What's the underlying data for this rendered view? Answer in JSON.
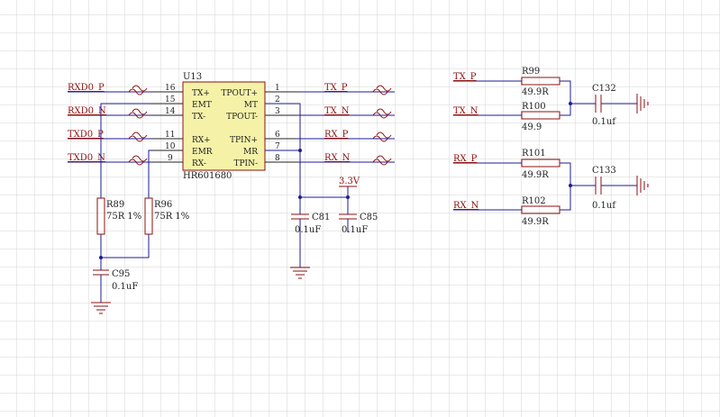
{
  "ic": {
    "ref": "U13",
    "part": "HR601680",
    "left_pins": [
      {
        "num": "16",
        "name": "TX+",
        "net": "RXD0_P"
      },
      {
        "num": "15",
        "name": "EMT",
        "net": ""
      },
      {
        "num": "14",
        "name": "TX-",
        "net": "RXD0_N"
      },
      {
        "num": "11",
        "name": "RX+",
        "net": "TXD0_P"
      },
      {
        "num": "10",
        "name": "EMR",
        "net": ""
      },
      {
        "num": "9",
        "name": "RX-",
        "net": "TXD0_N"
      }
    ],
    "right_pins": [
      {
        "num": "1",
        "name": "TPOUT+",
        "net": "TX_P"
      },
      {
        "num": "2",
        "name": "MT",
        "net": ""
      },
      {
        "num": "3",
        "name": "TPOUT-",
        "net": "TX_N"
      },
      {
        "num": "6",
        "name": "TPIN+",
        "net": "RX_P"
      },
      {
        "num": "7",
        "name": "MR",
        "net": ""
      },
      {
        "num": "8",
        "name": "TPIN-",
        "net": "RX_N"
      }
    ]
  },
  "resistors": {
    "r89": {
      "ref": "R89",
      "value": "75R 1%"
    },
    "r96": {
      "ref": "R96",
      "value": "75R 1%"
    },
    "r99": {
      "ref": "R99",
      "value": "49.9R"
    },
    "r100": {
      "ref": "R100",
      "value": "49.9"
    },
    "r101": {
      "ref": "R101",
      "value": "49.9R"
    },
    "r102": {
      "ref": "R102",
      "value": "49.9R"
    }
  },
  "capacitors": {
    "c95": {
      "ref": "C95",
      "value": "0.1uF"
    },
    "c81": {
      "ref": "C81",
      "value": "0.1uF"
    },
    "c85": {
      "ref": "C85",
      "value": "0.1uF"
    },
    "c132": {
      "ref": "C132",
      "value": "0.1uf"
    },
    "c133": {
      "ref": "C133",
      "value": "0.1uf"
    }
  },
  "power": {
    "label": "3.3V"
  },
  "nets_right_block": {
    "tx_p": "TX_P",
    "tx_n": "TX_N",
    "rx_p": "RX_P",
    "rx_n": "RX_N"
  },
  "colors": {
    "wire": "#1b1b9a",
    "component": "#8b1010",
    "ic_fill": "#f5f2a8",
    "grid": "#d6d6d6"
  }
}
